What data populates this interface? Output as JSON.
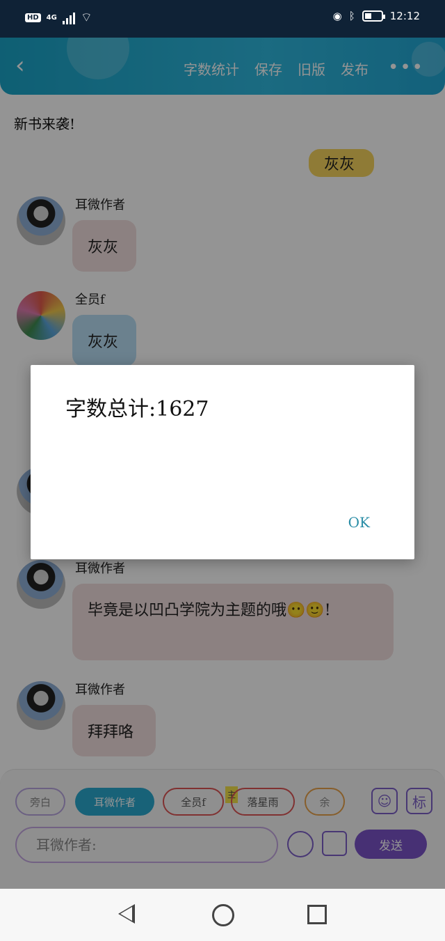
{
  "status": {
    "left_badge": "HD",
    "network": "4G",
    "time": "12:12",
    "icons": [
      "eye-icon",
      "bluetooth-icon"
    ]
  },
  "header": {
    "back_icon": "chevron-left-icon",
    "actions": [
      "字数统计",
      "保存",
      "旧版",
      "发布"
    ],
    "more": "•••"
  },
  "book_title": "新书来袭!",
  "messages": [
    {
      "name": "",
      "text": "灰灰",
      "style": "yellow"
    },
    {
      "name": "耳微作者",
      "text": "灰灰",
      "style": "pink"
    },
    {
      "name": "全员f",
      "text": "灰灰",
      "style": "blue"
    },
    {
      "name": "耳微作者",
      "text": "毕竟是以凹凸学院为主题的哦😶🙂!",
      "style": "pink"
    },
    {
      "name": "耳微作者",
      "text": "拜拜咯",
      "style": "pink"
    }
  ],
  "composer": {
    "chips": [
      "旁白",
      "耳微作者",
      "全员f",
      "落星雨",
      "余"
    ],
    "chip_tag": "主",
    "role_icon": "person-icon",
    "tag_label": "标",
    "input_placeholder": "耳微作者:",
    "emoji_icon": "smiley-icon",
    "image_icon": "image-icon",
    "send_label": "发送"
  },
  "dialog": {
    "message": "字数总计:1627",
    "ok_label": "OK"
  },
  "nav": {
    "back": "triangle-back-icon",
    "home": "circle-home-icon",
    "recent": "square-recent-icon"
  }
}
